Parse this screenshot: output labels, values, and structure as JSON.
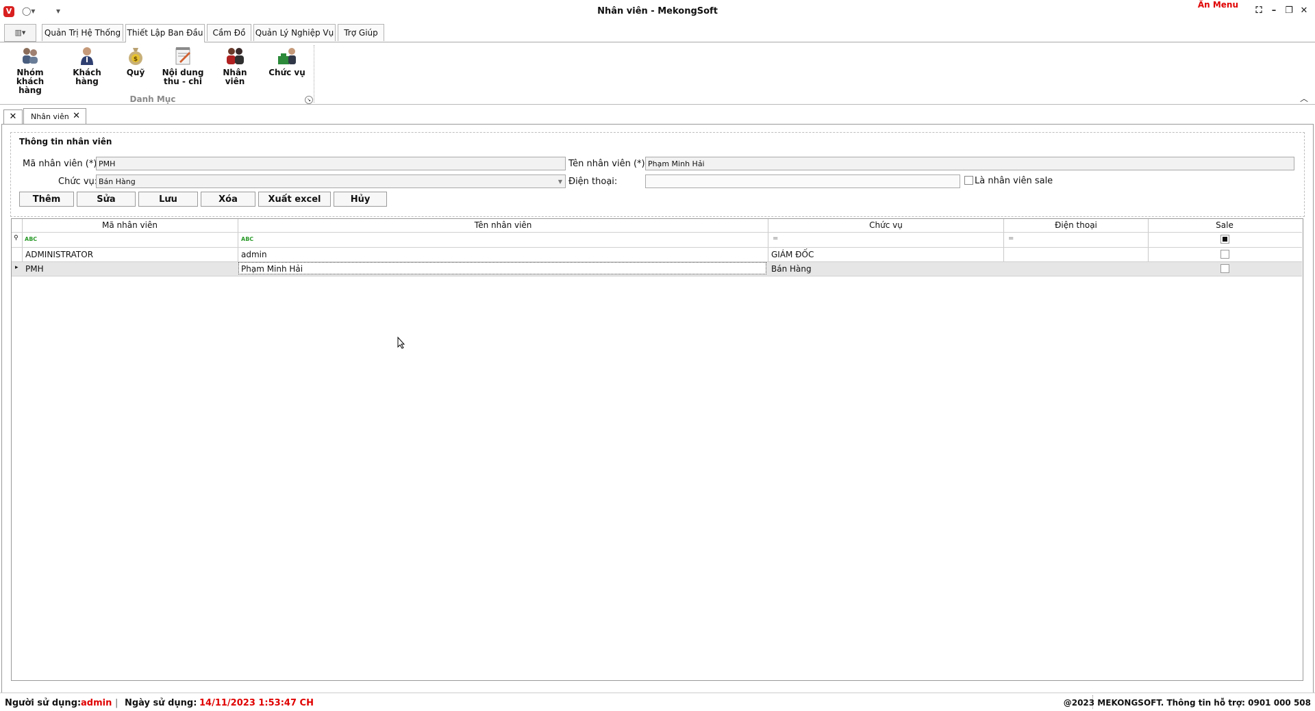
{
  "window": {
    "title": "Nhân viên - MekongSoft",
    "hide_menu": "Ẩn Menu",
    "logo_letter": "V"
  },
  "ribbon": {
    "tabs": [
      "Quản Trị Hệ Thống",
      "Thiết Lập Ban Đầu",
      "Cầm Đồ",
      "Quản Lý Nghiệp Vụ",
      "Trợ Giúp"
    ],
    "active_tab": "Thiết Lập Ban Đầu",
    "buttons": [
      {
        "label": "Nhóm khách hàng",
        "icon": "customer-group-icon"
      },
      {
        "label": "Khách hàng",
        "icon": "customer-icon"
      },
      {
        "label": "Quỹ",
        "icon": "money-bag-icon"
      },
      {
        "label": "Nội dung thu - chi",
        "icon": "notepad-icon"
      },
      {
        "label": "Nhân viên",
        "icon": "employees-icon"
      },
      {
        "label": "Chức vụ",
        "icon": "position-icon"
      }
    ],
    "group_label": "Danh Mục"
  },
  "doc_tab": {
    "label": "Nhân viên"
  },
  "form": {
    "section_title": "Thông tin nhân viên",
    "code_label": "Mã nhân viên (*):",
    "code_value": "PMH",
    "name_label": "Tên nhân viên (*):",
    "name_value": "Phạm Minh Hải",
    "position_label": "Chức vụ:",
    "position_value": "Bán Hàng",
    "phone_label": "Điện thoại:",
    "phone_value": "",
    "sale_label": "Là nhân viên sale",
    "buttons": {
      "add": "Thêm",
      "edit": "Sửa",
      "save": "Lưu",
      "delete": "Xóa",
      "export": "Xuất excel",
      "cancel": "Hủy"
    }
  },
  "grid": {
    "columns": [
      "Mã nhân viên",
      "Tên nhân viên",
      "Chức vụ",
      "Điện thoại",
      "Sale"
    ],
    "rows": [
      {
        "code": "ADMINISTRATOR",
        "name": "admin",
        "position": "GIÁM ĐỐC",
        "phone": "",
        "sale": false
      },
      {
        "code": "PMH",
        "name": "Phạm Minh Hải",
        "position": "Bán Hàng",
        "phone": "",
        "sale": false
      }
    ]
  },
  "status": {
    "user_label": "Người sử dụng:",
    "user_value": "admin",
    "separator": "|",
    "date_label": "Ngày sử dụng:",
    "date_value": "14/11/2023 1:53:47 CH",
    "copyright": "@2023 MEKONGSOFT. Thông tin hỗ trợ: 0901 000 508"
  }
}
